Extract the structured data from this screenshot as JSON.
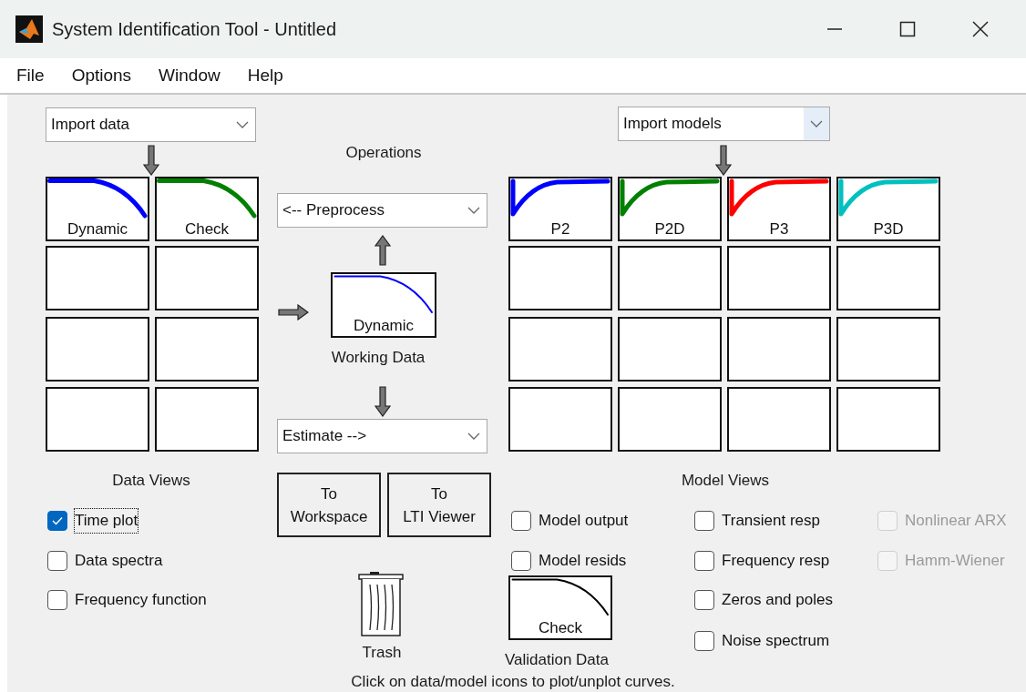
{
  "window": {
    "title": "System Identification Tool - Untitled"
  },
  "menu": [
    "File",
    "Options",
    "Window",
    "Help"
  ],
  "data": {
    "import": "Import data",
    "tiles": [
      {
        "kind": "data",
        "label": "Dynamic",
        "color": "#0000ff"
      },
      {
        "kind": "data",
        "label": "Check",
        "color": "#008000"
      },
      {
        "kind": "empty"
      },
      {
        "kind": "empty"
      },
      {
        "kind": "empty"
      },
      {
        "kind": "empty"
      },
      {
        "kind": "empty"
      },
      {
        "kind": "empty"
      }
    ]
  },
  "operations": {
    "title": "Operations",
    "preprocess": "<-- Preprocess",
    "working_data": {
      "label": "Dynamic",
      "caption": "Working Data",
      "color": "#0000ff"
    },
    "estimate": "Estimate -->",
    "buttons": [
      "To\nWorkspace",
      "To\nLTI Viewer"
    ]
  },
  "models": {
    "import": "Import models",
    "tiles": [
      {
        "kind": "model",
        "label": "P2",
        "color": "#0000ff"
      },
      {
        "kind": "model",
        "label": "P2D",
        "color": "#008000"
      },
      {
        "kind": "model",
        "label": "P3",
        "color": "#ff0000"
      },
      {
        "kind": "model",
        "label": "P3D",
        "color": "#00c0c0"
      },
      {
        "kind": "empty"
      },
      {
        "kind": "empty"
      },
      {
        "kind": "empty"
      },
      {
        "kind": "empty"
      },
      {
        "kind": "empty"
      },
      {
        "kind": "empty"
      },
      {
        "kind": "empty"
      },
      {
        "kind": "empty"
      },
      {
        "kind": "empty"
      },
      {
        "kind": "empty"
      },
      {
        "kind": "empty"
      },
      {
        "kind": "empty"
      }
    ]
  },
  "data_views": {
    "title": "Data Views",
    "options": [
      {
        "label": "Time plot",
        "checked": true,
        "focused": true
      },
      {
        "label": "Data spectra",
        "checked": false,
        "focused": false
      },
      {
        "label": "Frequency function",
        "checked": false,
        "focused": false
      }
    ]
  },
  "model_views": {
    "title": "Model Views",
    "columns": [
      [
        {
          "label": "Model output",
          "checked": false,
          "disabled": false
        },
        {
          "label": "Model resids",
          "checked": false,
          "disabled": false
        }
      ],
      [
        {
          "label": "Transient resp",
          "checked": false,
          "disabled": false
        },
        {
          "label": "Frequency resp",
          "checked": false,
          "disabled": false
        },
        {
          "label": "Zeros and poles",
          "checked": false,
          "disabled": false
        },
        {
          "label": "Noise spectrum",
          "checked": false,
          "disabled": false
        }
      ],
      [
        {
          "label": "Nonlinear ARX",
          "checked": false,
          "disabled": true
        },
        {
          "label": "Hamm-Wiener",
          "checked": false,
          "disabled": true
        }
      ]
    ]
  },
  "trash": {
    "label": "Trash"
  },
  "validation": {
    "label": "Check",
    "caption": "Validation Data",
    "color": "#000000"
  },
  "footer": "Click on data/model icons to plot/unplot curves."
}
